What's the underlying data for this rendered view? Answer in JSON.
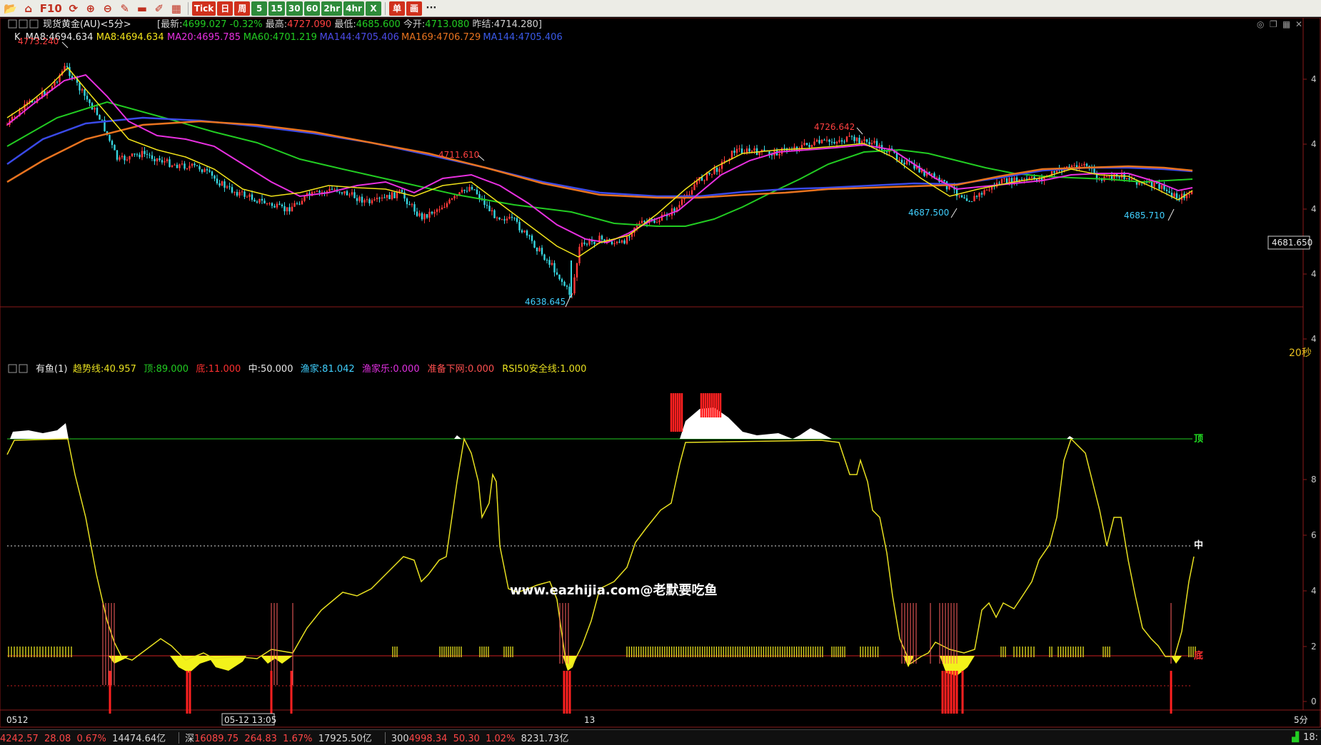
{
  "toolbar": {
    "buttons": [
      {
        "name": "folder-button",
        "label": "📂",
        "style": "icon"
      },
      {
        "name": "home-button",
        "label": "⌂",
        "style": "icon"
      },
      {
        "name": "f10-button",
        "label": "F10",
        "style": "icon"
      },
      {
        "name": "refresh-button",
        "label": "⟳",
        "style": "icon"
      },
      {
        "name": "zoom-in-button",
        "label": "⊕",
        "style": "icon"
      },
      {
        "name": "zoom-out-button",
        "label": "⊖",
        "style": "icon"
      },
      {
        "name": "draw-button",
        "label": "✎",
        "style": "icon"
      },
      {
        "name": "eraser-button",
        "label": "▬",
        "style": "icon"
      },
      {
        "name": "pen-button",
        "label": "✐",
        "style": "icon"
      },
      {
        "name": "table-button",
        "label": "▦",
        "style": "icon"
      },
      {
        "name": "tick-button",
        "label": "Tick",
        "style": "r"
      },
      {
        "name": "day-button",
        "label": "日",
        "style": "r"
      },
      {
        "name": "week-button",
        "label": "周",
        "style": "r"
      },
      {
        "name": "period-5-button",
        "label": "5",
        "style": "g"
      },
      {
        "name": "period-15-button",
        "label": "15",
        "style": "g"
      },
      {
        "name": "period-30-button",
        "label": "30",
        "style": "g"
      },
      {
        "name": "period-60-button",
        "label": "60",
        "style": "g"
      },
      {
        "name": "period-2hr-button",
        "label": "2hr",
        "style": "g"
      },
      {
        "name": "period-4hr-button",
        "label": "4hr",
        "style": "g"
      },
      {
        "name": "close-x-button",
        "label": "X",
        "style": "g"
      },
      {
        "name": "order-button",
        "label": "单",
        "style": "r"
      },
      {
        "name": "draw-tool-button",
        "label": "画",
        "style": "r"
      },
      {
        "name": "more-button",
        "label": "···",
        "style": ""
      }
    ]
  },
  "main": {
    "title": "现货黄金(AU)<5分>",
    "quote": {
      "latest_label": "最新:",
      "latest": "4699.027",
      "change": "-0.32%",
      "high_label": "最高:",
      "high": "4727.090",
      "low_label": "最低:",
      "low": "4685.600",
      "open_label": "今开:",
      "open": "4713.080",
      "prev_label": "昨结:",
      "prev": "4714.280"
    },
    "ma_line": [
      {
        "label": "K",
        "color": "#e8e8e8"
      },
      {
        "label": "MA8:4694.634",
        "color": "#e8e8e8"
      },
      {
        "label": "MA8:4694.634",
        "color": "#f2e31a"
      },
      {
        "label": "MA20:4695.785",
        "color": "#e830e0"
      },
      {
        "label": "MA60:4701.219",
        "color": "#22cc22"
      },
      {
        "label": "MA144:4705.406",
        "color": "#4c4ce8"
      },
      {
        "label": "MA169:4706.729",
        "color": "#e8731f"
      },
      {
        "label": "MA144:4705.406",
        "color": "#3a5ae8"
      }
    ],
    "annotations": [
      {
        "text": "4773.240",
        "color": "#ff4040"
      },
      {
        "text": "4711.610",
        "color": "#ff4040"
      },
      {
        "text": "4726.642",
        "color": "#ff4040"
      },
      {
        "text": "4687.500",
        "color": "#40d0ff"
      },
      {
        "text": "4685.710",
        "color": "#40d0ff"
      },
      {
        "text": "4638.645",
        "color": "#40d0ff"
      }
    ],
    "price_box": "4681.650",
    "timer": "20秒",
    "right_axis": [
      "4",
      "4",
      "4",
      "4",
      "4",
      "4"
    ]
  },
  "indicator": {
    "name": "有鱼(1)",
    "params": [
      {
        "label": "趋势线:40.957",
        "color": "#e8e020"
      },
      {
        "label": "顶:89.000",
        "color": "#22cc22"
      },
      {
        "label": "底:11.000",
        "color": "#ff3030"
      },
      {
        "label": "中:50.000",
        "color": "#e8e8e8"
      },
      {
        "label": "渔家:81.042",
        "color": "#40d0ff"
      },
      {
        "label": "渔家乐:0.000",
        "color": "#e030e0"
      },
      {
        "label": "准备下网:0.000",
        "color": "#ff5050"
      },
      {
        "label": "RSI50安全线:1.000",
        "color": "#e8e020"
      }
    ],
    "top_label": "顶",
    "mid_label": "中",
    "bottom_label": "底",
    "right_axis": [
      "8",
      "6",
      "4",
      "2",
      "0"
    ],
    "watermark": "www.eazhijia.com@老默要吃鱼"
  },
  "xaxis": {
    "start": "0512",
    "cursor_time": "05-12 13:05",
    "mid": "13",
    "period": "5分"
  },
  "status": {
    "items": [
      {
        "name": "index-1",
        "parts": [
          [
            "4242.57",
            "up"
          ],
          [
            "  28.08",
            "up"
          ],
          [
            "  0.67%",
            "up"
          ],
          [
            "  14474.64亿",
            "wh"
          ]
        ]
      },
      {
        "name": "index-sz",
        "parts": [
          [
            "深",
            "wh"
          ],
          [
            "16089.75",
            "up"
          ],
          [
            "  264.83",
            "up"
          ],
          [
            "  1.67%",
            "up"
          ],
          [
            "  17925.50亿",
            "wh"
          ]
        ]
      },
      {
        "name": "index-300",
        "parts": [
          [
            "300",
            "wh"
          ],
          [
            "4998.34",
            "up"
          ],
          [
            "  50.30",
            "up"
          ],
          [
            "  1.02%",
            "up"
          ],
          [
            "  8231.73亿",
            "wh"
          ]
        ]
      }
    ],
    "clock": "18:"
  }
}
